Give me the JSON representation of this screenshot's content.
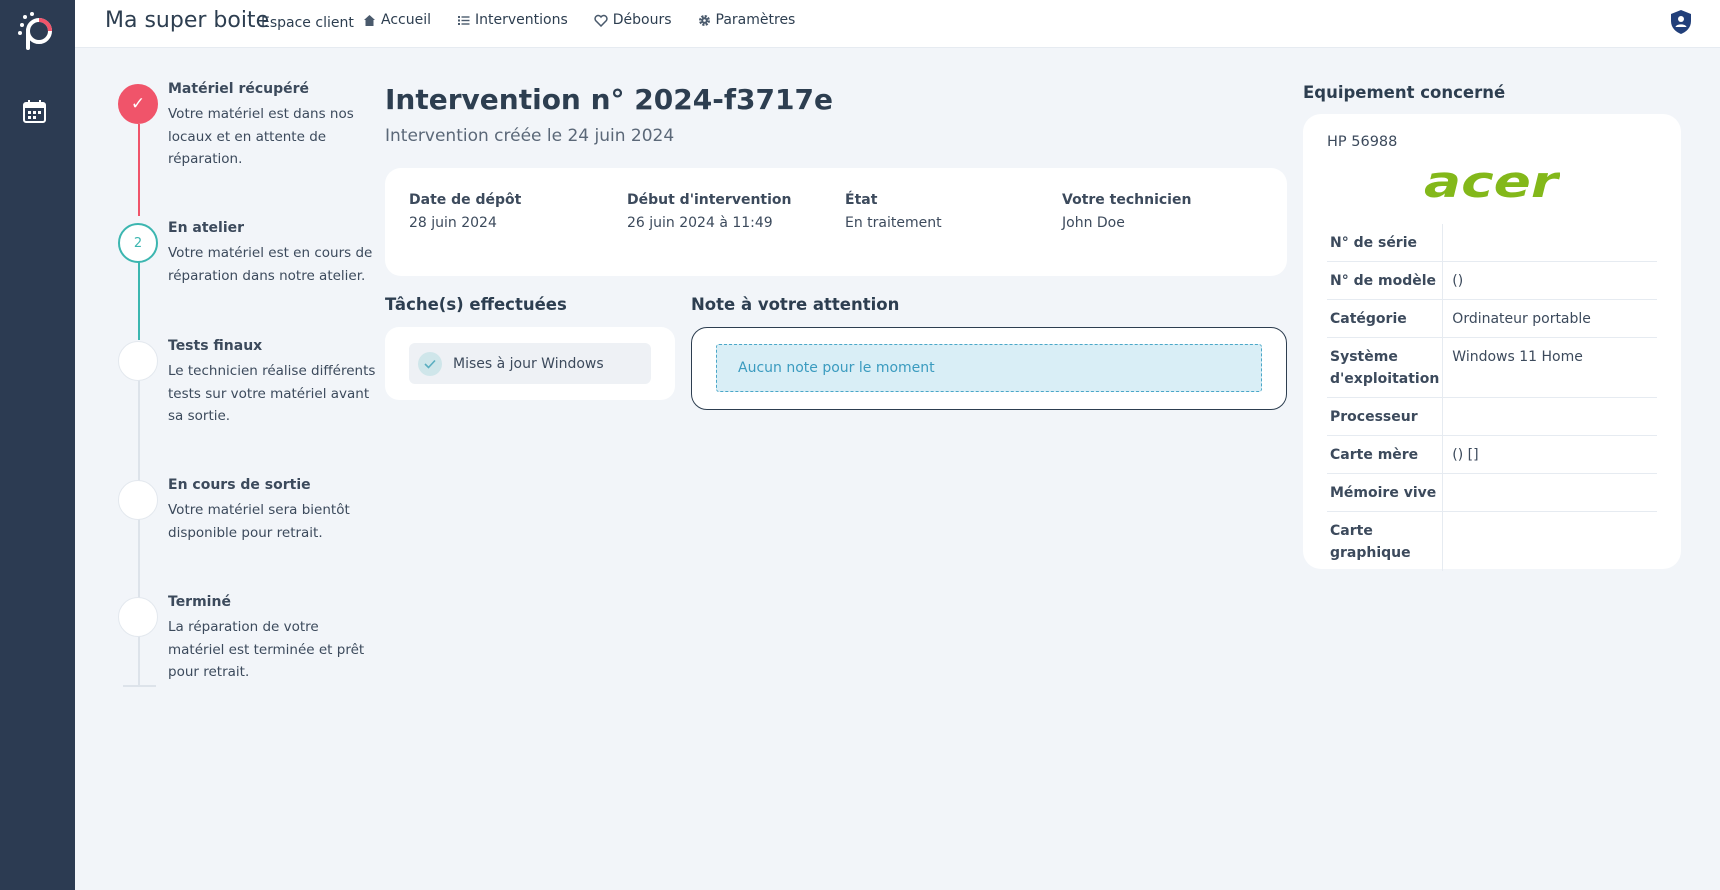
{
  "header": {
    "brand": "Ma super boite",
    "subbrand": "Espace client",
    "nav": [
      {
        "label": "Accueil",
        "icon": "home-icon"
      },
      {
        "label": "Interventions",
        "icon": "list-icon"
      },
      {
        "label": "Débours",
        "icon": "heart-hand-icon"
      },
      {
        "label": "Paramètres",
        "icon": "gear-icon"
      }
    ]
  },
  "steps": [
    {
      "title": "Matériel récupéré",
      "desc": "Votre matériel est dans nos locaux et en attente de réparation.",
      "marker": "✓",
      "status": "done"
    },
    {
      "title": "En atelier",
      "desc": "Votre matériel est en cours de réparation dans notre atelier.",
      "marker": "2",
      "status": "current"
    },
    {
      "title": "Tests finaux",
      "desc": "Le technicien réalise différents tests sur votre matériel avant sa sortie.",
      "marker": "",
      "status": "todo"
    },
    {
      "title": "En cours de sortie",
      "desc": "Votre matériel sera bientôt disponible pour retrait.",
      "marker": "",
      "status": "todo"
    },
    {
      "title": "Terminé",
      "desc": "La réparation de votre matériel est terminée et prêt pour retrait.",
      "marker": "",
      "status": "todo"
    }
  ],
  "main": {
    "title": "Intervention n° 2024-f3717e",
    "subtitle": "Intervention créée le 24 juin 2024",
    "info": [
      {
        "label": "Date de dépôt",
        "value": "28 juin 2024"
      },
      {
        "label": "Début d'intervention",
        "value": "26 juin 2024 à 11:49"
      },
      {
        "label": "État",
        "value": "En traitement"
      },
      {
        "label": "Votre technicien",
        "value": "John Doe"
      }
    ],
    "tasks_title": "Tâche(s) effectuées",
    "tasks": [
      "Mises à jour Windows"
    ],
    "note_title": "Note à votre attention",
    "note_empty": "Aucun note pour le moment"
  },
  "equipment": {
    "title": "Equipement concerné",
    "name": "HP 56988",
    "brand_logo": "acer",
    "rows": [
      {
        "key": "N° de série",
        "value": ""
      },
      {
        "key": "N° de modèle",
        "value": "()"
      },
      {
        "key": "Catégorie",
        "value": "Ordinateur portable"
      },
      {
        "key": "Système d'exploitation",
        "value": "Windows 11 Home"
      },
      {
        "key": "Processeur",
        "value": ""
      },
      {
        "key": "Carte mère",
        "value": "() []"
      },
      {
        "key": "Mémoire vive",
        "value": ""
      },
      {
        "key": "Carte graphique",
        "value": ""
      }
    ]
  },
  "colors": {
    "sidebar": "#2c3b52",
    "done": "#f0546a",
    "current": "#3cb6b0",
    "acer": "#83b81a"
  }
}
